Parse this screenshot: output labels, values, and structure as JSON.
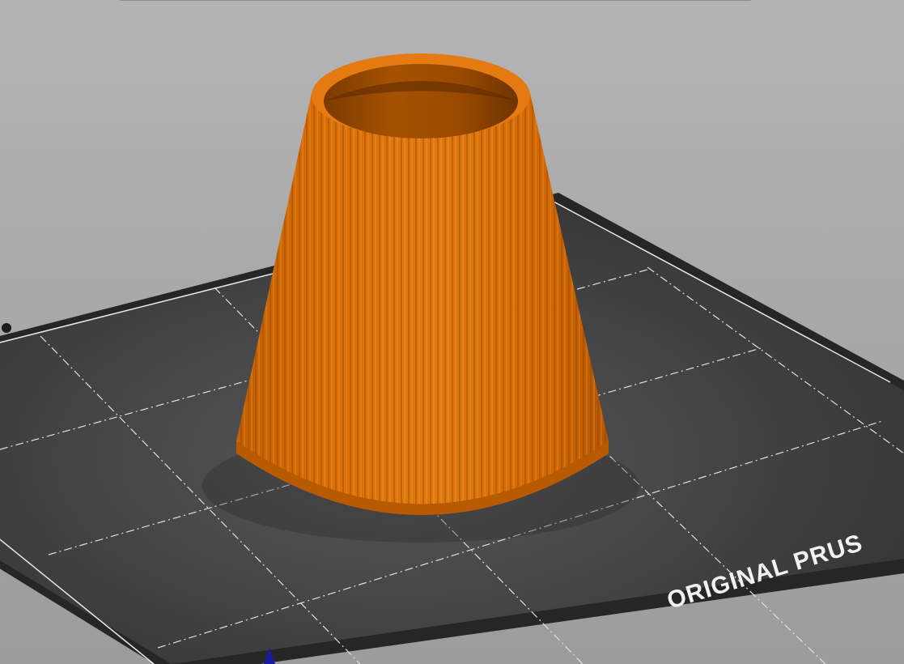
{
  "app": {
    "bed_label": "ORIGINAL PRUS",
    "top_bar_label": ""
  },
  "colors": {
    "background": "#aaaaaa",
    "bed_surface": "#3d3d3d",
    "bed_frame": "#262626",
    "grid_line": "#e8e8e8",
    "model_primary": "#d86b00",
    "model_shadow": "#9a4a00",
    "axis_z": "#1a1aa0"
  },
  "icons": {
    "axis_indicator": "z-axis-arrow-icon",
    "bed_edge_marker": "bed-corner-dot-icon"
  }
}
